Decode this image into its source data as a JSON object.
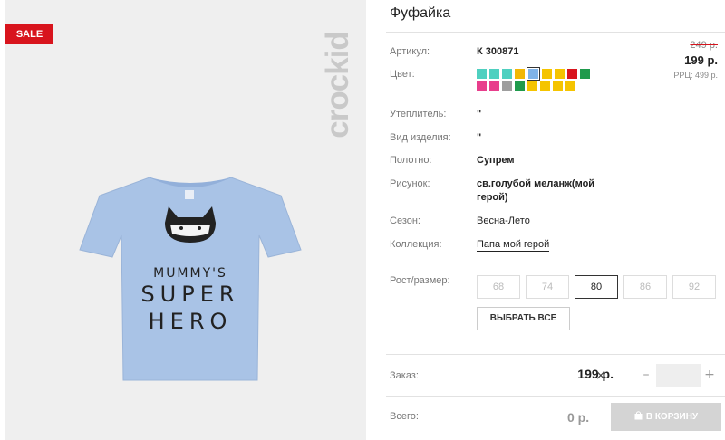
{
  "badge": "SALE",
  "brand": "crockid",
  "product": {
    "title": "Фуфайка",
    "print_lines": [
      "MUMMY'S",
      "SUPER",
      "HERO"
    ]
  },
  "pricing": {
    "old_price": "249 р.",
    "price": "199 р.",
    "rrp": "РРЦ: 499 р."
  },
  "specs": {
    "article_label": "Артикул:",
    "article_value": "К 300871",
    "color_label": "Цвет:",
    "insulation_label": "Утеплитель:",
    "insulation_value": "\"",
    "type_label": "Вид изделия:",
    "type_value": "\"",
    "fabric_label": "Полотно:",
    "fabric_value": "Супрем",
    "pattern_label": "Рисунок:",
    "pattern_value_line1": "св.голубой меланж(мой",
    "pattern_value_line2": "герой)",
    "season_label": "Сезон:",
    "season_value": "Весна-Лето",
    "collection_label": "Коллекция:",
    "collection_value": "Папа мой герой"
  },
  "swatches": {
    "row1": [
      "#4fd0c0",
      "#4fd0c0",
      "#4fd0c0",
      "#f2b705",
      "#7fb3e8",
      "#f5c400",
      "#f5c400",
      "#d8141d",
      "#1f9a4c"
    ],
    "row2": [
      "#e83e8c",
      "#e83e8c",
      "#9e9e9e",
      "#1f9a4c",
      "#f5c400",
      "#f5c400",
      "#f5c400",
      "#f5c400"
    ],
    "selected_row1_index": 4
  },
  "sizes": {
    "label": "Рост/размер:",
    "options": [
      "68",
      "74",
      "80",
      "86",
      "92"
    ],
    "active": "80",
    "select_all": "ВЫБРАТЬ ВСЕ"
  },
  "order": {
    "label": "Заказ:",
    "price": "199 р.",
    "remove": "×",
    "minus": "–",
    "plus": "+",
    "quantity": ""
  },
  "total": {
    "label": "Всего:",
    "value": "0 р.",
    "cart_button": "В КОРЗИНУ"
  },
  "colors": {
    "sale": "#d8141d",
    "shirt": "#a9c3e6",
    "cart_disabled": "#d4d4d4"
  }
}
